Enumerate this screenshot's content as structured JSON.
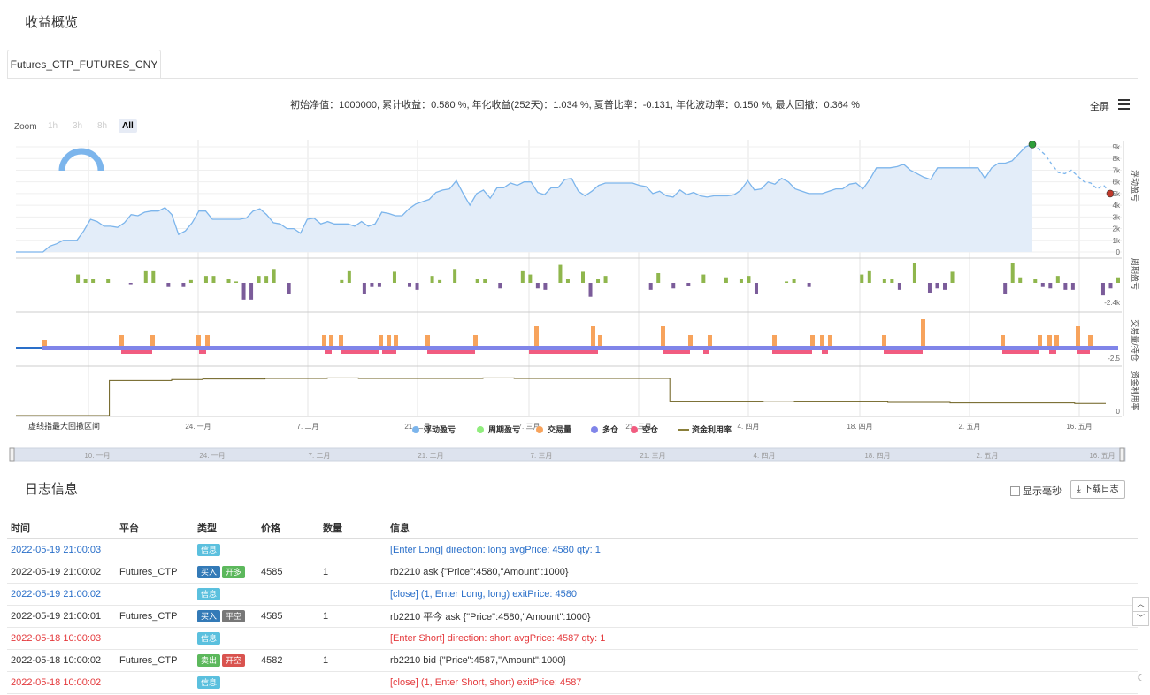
{
  "overview": {
    "title": "收益概览",
    "tab_label": "Futures_CTP_FUTURES_CNY",
    "stats_text": "初始净值：1000000, 累计收益：0.580 %, 年化收益(252天)：1.034 %, 夏普比率：-0.131, 年化波动率：0.150 %, 最大回撤：0.364 %",
    "fullscreen_label": "全屏",
    "menu_icon": "hamburger-menu-icon",
    "zoom": {
      "label": "Zoom",
      "options": [
        "1h",
        "3h",
        "8h",
        "All"
      ],
      "selected": "All"
    }
  },
  "chart_data": {
    "type": "line",
    "title": "",
    "x_tick_labels": [
      "24. 一月",
      "7. 二月",
      "21. 二月",
      "7. 三月",
      "21. 三月",
      "4. 四月",
      "18. 四月",
      "2. 五月",
      "16. 五月"
    ],
    "navigator_labels": [
      "10. 一月",
      "24. 一月",
      "7. 二月",
      "21. 二月",
      "7. 三月",
      "21. 三月",
      "4. 四月",
      "18. 四月",
      "2. 五月",
      "16. 五月"
    ],
    "note_label": "虚线指最大回撤区间",
    "panes": [
      {
        "ylabel": "浮动盈亏",
        "y_ticks": [
          "9k",
          "8k",
          "7k",
          "6k",
          "5k",
          "4k",
          "3k",
          "2k",
          "1k",
          "0"
        ],
        "ylim": [
          0,
          9000
        ]
      },
      {
        "ylabel": "周期盈亏",
        "y_ticks": [
          "-2.4k"
        ]
      },
      {
        "ylabel": "交易量/持仓",
        "y_ticks": [
          "-2.5"
        ]
      },
      {
        "ylabel": "资金利用率",
        "y_ticks": [
          "0"
        ]
      }
    ],
    "legend": [
      "浮动盈亏",
      "周期盈亏",
      "交易量",
      "多仓",
      "空仓",
      "资金利用率"
    ],
    "legend_colors": [
      "#7cb5ec",
      "#90ed7d",
      "#f7a35c",
      "#8085e9",
      "#f15c80",
      "#8a7f3a"
    ],
    "equity": [
      0,
      0,
      0,
      0,
      0,
      500,
      700,
      1000,
      1000,
      1000,
      1800,
      2800,
      2600,
      2200,
      2200,
      2100,
      2500,
      3200,
      3100,
      3400,
      3500,
      3500,
      3800,
      3200,
      1500,
      1800,
      2500,
      3500,
      3500,
      2800,
      2800,
      2800,
      2800,
      2800,
      2900,
      3500,
      3700,
      3200,
      2500,
      2400,
      2000,
      2000,
      1600,
      2800,
      2900,
      2400,
      2600,
      2400,
      2400,
      2400,
      2200,
      2600,
      2200,
      2400,
      3400,
      3300,
      3100,
      3100,
      3700,
      4100,
      4300,
      4500,
      5100,
      5300,
      5400,
      6100,
      5000,
      4000,
      5000,
      5300,
      4600,
      5500,
      5500,
      5900,
      5700,
      6000,
      6000,
      5100,
      4900,
      5500,
      5500,
      6200,
      6300,
      5200,
      4800,
      5200,
      5700,
      5900,
      5900,
      5900,
      5900,
      5900,
      5700,
      5600,
      5000,
      5200,
      4800,
      4700,
      5300,
      4900,
      5100,
      4800,
      4700,
      4800,
      4800,
      4800,
      4900,
      5300,
      6100,
      5300,
      5400,
      6000,
      5800,
      6300,
      6000,
      5400,
      5200,
      5000,
      5000,
      5000,
      5200,
      5400,
      5400,
      5800,
      5900,
      5400,
      6200,
      7200,
      7200,
      7200,
      7300,
      7500,
      7000,
      6700,
      6400,
      6200,
      7200,
      7200,
      7200,
      7200,
      7200,
      7200,
      7200,
      6300,
      7200,
      7600,
      7600,
      7800,
      8400,
      9000,
      9200
    ],
    "equity_drawdown": [
      9200,
      8800,
      8300,
      7500,
      6800,
      6700,
      7000,
      6500,
      6000,
      5900,
      5400,
      5700,
      5000
    ],
    "equity_peak_marker": 9200,
    "equity_end_marker": 5000,
    "period_pnl": [
      0,
      0,
      0,
      0,
      600,
      300,
      300,
      0,
      300,
      0,
      0,
      -100,
      0,
      900,
      900,
      0,
      -300,
      0,
      -300,
      200,
      0,
      500,
      500,
      0,
      300,
      100,
      -1200,
      -1200,
      500,
      500,
      1000,
      0,
      -800,
      0,
      0,
      0,
      0,
      0,
      0,
      200,
      900,
      0,
      -800,
      -300,
      -300,
      0,
      800,
      0,
      -300,
      -500,
      0,
      500,
      200,
      0,
      1000,
      0,
      0,
      300,
      300,
      0,
      -400,
      0,
      0,
      900,
      600,
      -400,
      -500,
      0,
      1300,
      300,
      0,
      800,
      -1000,
      300,
      500,
      0,
      0,
      0,
      0,
      0,
      -500,
      700,
      0,
      -400,
      0,
      -200,
      0,
      600,
      0,
      0,
      400,
      0,
      300,
      500,
      -800,
      0,
      0,
      0,
      100,
      300,
      0,
      -300,
      0,
      0,
      0,
      0,
      0,
      0,
      600,
      900,
      0,
      300,
      300,
      -500,
      0,
      1400,
      0,
      -700,
      -400,
      -500,
      800,
      0,
      0,
      0,
      0,
      0,
      0,
      -800,
      1400,
      400,
      0,
      300,
      -300,
      -400,
      500,
      -500,
      -500,
      0,
      0,
      0,
      -900,
      -400,
      400
    ],
    "volume_bars": [
      {
        "x": "24. 一月",
        "v": 1
      },
      {
        "x": "7. 二月",
        "v": 1
      },
      {
        "x": "21. 二月",
        "v": 1
      },
      {
        "x": "7. 三月",
        "v": 2
      },
      {
        "x": "21. 三月",
        "v": 2
      },
      {
        "x": "16. 五月",
        "v": 2
      }
    ],
    "utilization": [
      0,
      0,
      0,
      0.66,
      0.66,
      0.68,
      0.69,
      0.69,
      0.7,
      0.7,
      0.71,
      0.7,
      0.7,
      0.7,
      0.7,
      0.71,
      0.7,
      0.7,
      0.7,
      0.7,
      0.7,
      0.26,
      0.26,
      0.26,
      0.27,
      0.26,
      0.26,
      0.26,
      0.25,
      0.25,
      0.24,
      0.24,
      0.24,
      0.24,
      0.23,
      0.23
    ]
  },
  "log": {
    "title": "日志信息",
    "show_ms_label": "显示毫秒",
    "download_label": "下载日志",
    "columns": [
      "时间",
      "平台",
      "类型",
      "价格",
      "数量",
      "信息"
    ],
    "rows": [
      {
        "time": "2022-05-19 21:00:03",
        "platform": "",
        "badges": [
          {
            "text": "信息",
            "color": "#5bc0de"
          }
        ],
        "price": "",
        "amount": "",
        "info": "[Enter Long] direction: long avgPrice: 4580 qty: 1",
        "tone": "blue"
      },
      {
        "time": "2022-05-19 21:00:02",
        "platform": "Futures_CTP",
        "badges": [
          {
            "text": "买入",
            "color": "#337ab7"
          },
          {
            "text": "开多",
            "color": "#5cb85c"
          }
        ],
        "price": "4585",
        "amount": "1",
        "info": "rb2210 ask {\"Price\":4580,\"Amount\":1000}",
        "tone": "normal"
      },
      {
        "time": "2022-05-19 21:00:02",
        "platform": "",
        "badges": [
          {
            "text": "信息",
            "color": "#5bc0de"
          }
        ],
        "price": "",
        "amount": "",
        "info": "[close] (1, Enter Long, long) exitPrice: 4580",
        "tone": "blue"
      },
      {
        "time": "2022-05-19 21:00:01",
        "platform": "Futures_CTP",
        "badges": [
          {
            "text": "买入",
            "color": "#337ab7"
          },
          {
            "text": "平空",
            "color": "#777777"
          }
        ],
        "price": "4585",
        "amount": "1",
        "info": "rb2210 平今 ask {\"Price\":4580,\"Amount\":1000}",
        "tone": "normal"
      },
      {
        "time": "2022-05-18 10:00:03",
        "platform": "",
        "badges": [
          {
            "text": "信息",
            "color": "#5bc0de"
          }
        ],
        "price": "",
        "amount": "",
        "info": "[Enter Short] direction: short avgPrice: 4587 qty: 1",
        "tone": "red"
      },
      {
        "time": "2022-05-18 10:00:02",
        "platform": "Futures_CTP",
        "badges": [
          {
            "text": "卖出",
            "color": "#5cb85c"
          },
          {
            "text": "开空",
            "color": "#d9534f"
          }
        ],
        "price": "4582",
        "amount": "1",
        "info": "rb2210 bid {\"Price\":4587,\"Amount\":1000}",
        "tone": "normal"
      },
      {
        "time": "2022-05-18 10:00:02",
        "platform": "",
        "badges": [
          {
            "text": "信息",
            "color": "#5bc0de"
          }
        ],
        "price": "",
        "amount": "",
        "info": "[close] (1, Enter Short, short) exitPrice: 4587",
        "tone": "red"
      }
    ]
  }
}
